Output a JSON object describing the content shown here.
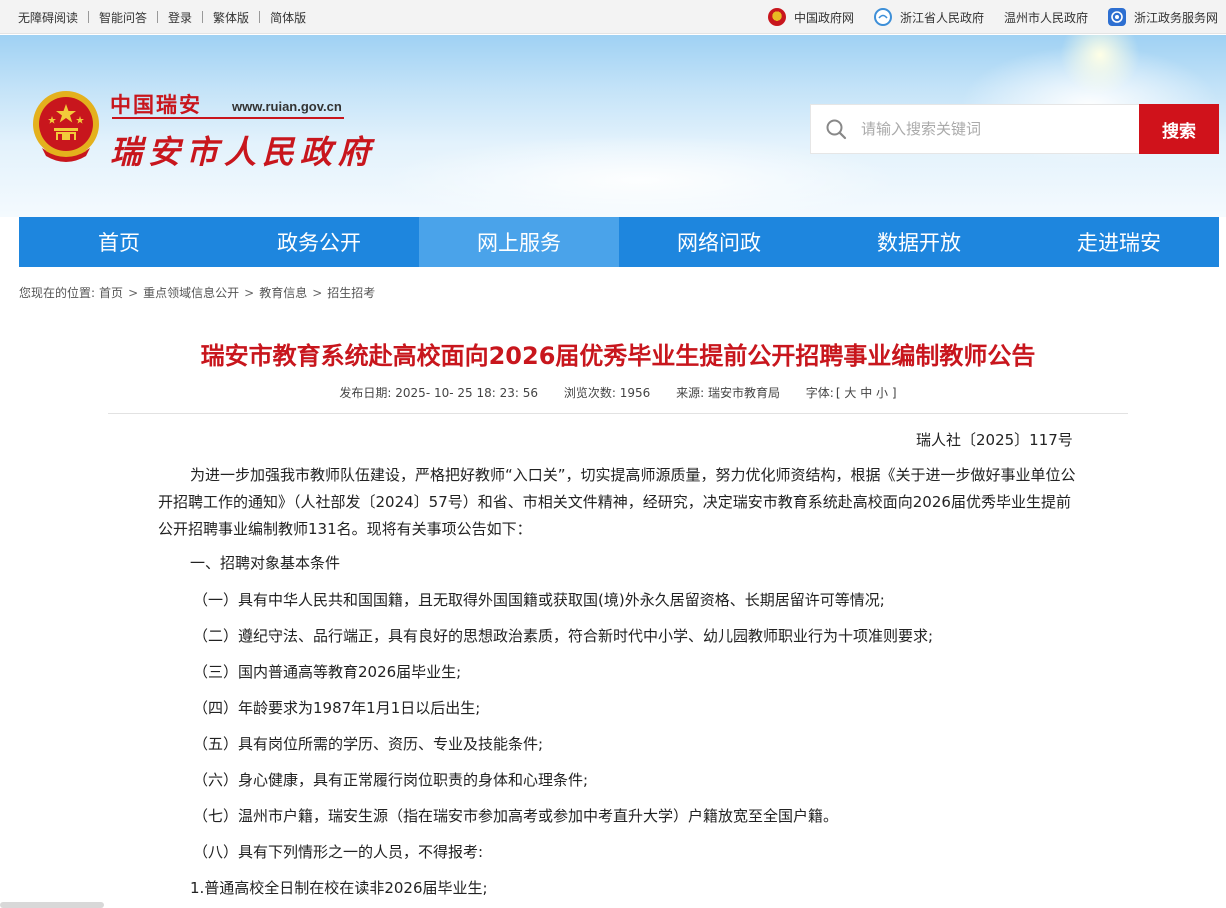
{
  "topbar": {
    "left_links": [
      "无障碍阅读",
      "智能问答",
      "登录",
      "繁体版",
      "简体版"
    ],
    "right_links": [
      {
        "label": "中国政府网",
        "icon": "national-emblem-icon"
      },
      {
        "label": "浙江省人民政府",
        "icon": "zhejiang-gov-icon"
      },
      {
        "label": "温州市人民政府",
        "icon": ""
      },
      {
        "label": "浙江政务服务网",
        "icon": "zhejiang-service-icon"
      }
    ]
  },
  "header": {
    "logo_cn": "中国瑞安",
    "logo_url": "www.ruian.gov.cn",
    "logo_main": "瑞安市人民政府",
    "search_placeholder": "请输入搜索关键词",
    "search_button": "搜索"
  },
  "nav": {
    "items": [
      "首页",
      "政务公开",
      "网上服务",
      "网络问政",
      "数据开放",
      "走进瑞安"
    ],
    "active_index": 2
  },
  "breadcrumb": {
    "prefix": "您现在的位置:",
    "items": [
      "首页",
      "重点领域信息公开",
      "教育信息",
      "招生招考"
    ]
  },
  "article": {
    "title": "瑞安市教育系统赴高校面向2026届优秀毕业生提前公开招聘事业编制教师公告",
    "meta": {
      "publish_label": "发布日期:",
      "publish_value": "2025- 10- 25 18: 23: 56",
      "views_label": "浏览次数:",
      "views_value": "1956",
      "source_label": "来源:",
      "source_value": "瑞安市教育局",
      "font_label": "字体:",
      "font_open": "[",
      "font_large": "大",
      "font_medium": "中",
      "font_small": "小",
      "font_close": "]"
    },
    "doc_number": "瑞人社〔2025〕117号",
    "intro": "为进一步加强我市教师队伍建设，严格把好教师“入口关”，切实提高师源质量，努力优化师资结构，根据《关于进一步做好事业单位公开招聘工作的通知》（人社部发〔2024〕57号）和省、市相关文件精神，经研究，决定瑞安市教育系统赴高校面向2026届优秀毕业生提前公开招聘事业编制教师131名。现将有关事项公告如下：",
    "section1_heading": "一、招聘对象基本条件",
    "conditions": [
      "（一）具有中华人民共和国国籍，且无取得外国国籍或获取国(境)外永久居留资格、长期居留许可等情况;",
      "（二）遵纪守法、品行端正，具有良好的思想政治素质，符合新时代中小学、幼儿园教师职业行为十项准则要求;",
      "（三）国内普通高等教育2026届毕业生;",
      "（四）年龄要求为1987年1月1日以后出生;",
      "（五）具有岗位所需的学历、资历、专业及技能条件;",
      "（六）身心健康，具有正常履行岗位职责的身体和心理条件;",
      "（七）温州市户籍，瑞安生源（指在瑞安市参加高考或参加中考直升大学）户籍放宽至全国户籍。",
      "（八）具有下列情形之一的人员，不得报考:"
    ],
    "exclusion_1": "1.普通高校全日制在校在读非2026届毕业生;"
  },
  "colors": {
    "brand_red": "#c8161d",
    "nav_blue": "#1e86de",
    "nav_active": "#4aa3ea",
    "search_btn": "#d0121b"
  }
}
